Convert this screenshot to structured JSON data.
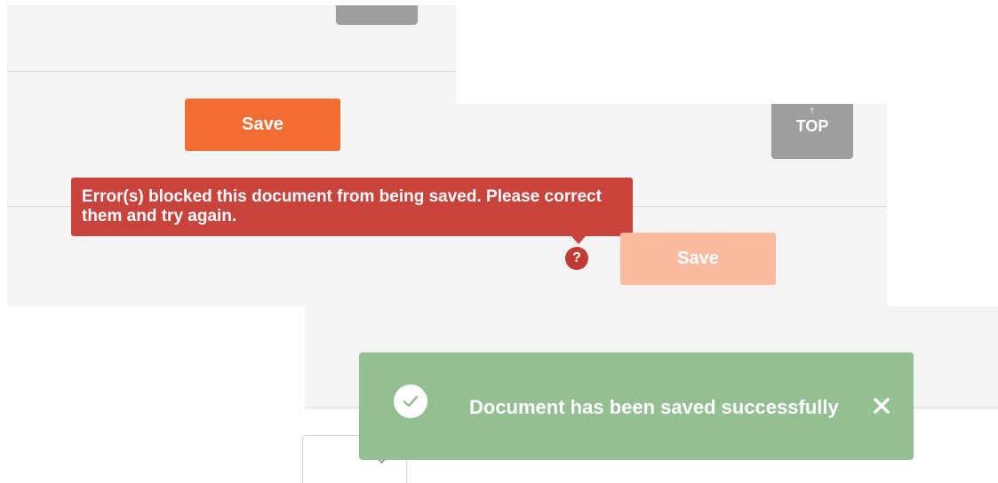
{
  "panel1": {
    "save_label": "Save"
  },
  "panel2": {
    "top_label": "TOP",
    "top_arrow": "↑",
    "save_label": "Save",
    "error_tooltip": "Error(s) blocked this document from being saved. Please correct them and try again.",
    "help_glyph": "?"
  },
  "toast": {
    "message": "Document has been saved successfully",
    "icon": "check-circle-icon",
    "close_icon": "close-icon"
  },
  "colors": {
    "save_primary": "#f26d33",
    "save_disabled": "#f8bba0",
    "error": "#c8433b",
    "success": "#93bf93",
    "grey_button": "#9e9e9e",
    "panel_bg": "#f4f4f4"
  }
}
